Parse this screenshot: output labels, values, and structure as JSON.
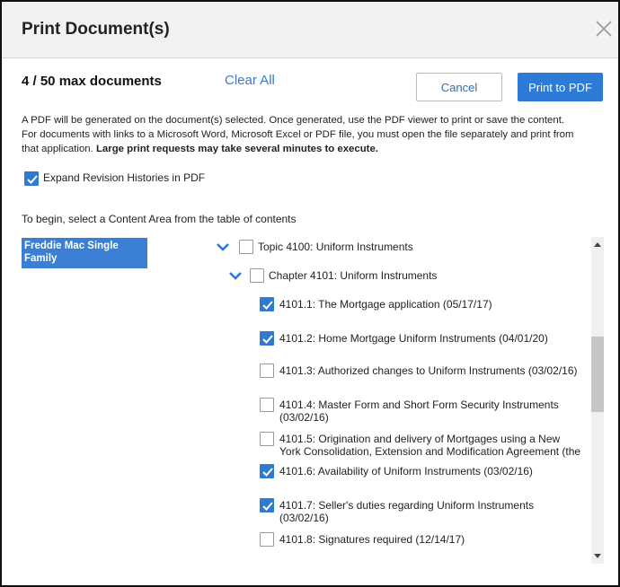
{
  "dialog": {
    "title": "Print Document(s)",
    "count_label": "4 / 50 max documents",
    "clear_all": "Clear All",
    "cancel_label": "Cancel",
    "print_label": "Print to PDF",
    "info_line1": "A PDF will be generated on the document(s) selected. Once generated, use the PDF viewer to print or save the content.",
    "info_line2": "For documents with links to a Microsoft Word, Microsoft Excel or PDF file, you must open the file separately and print from",
    "info_line3": "that application.",
    "info_bold": "Large print requests may take several minutes to execute.",
    "expand_label": "Expand Revision Histories in PDF",
    "expand_checked": true,
    "begin_text": "To begin, select a Content Area from the table of contents"
  },
  "content_areas": [
    {
      "label": "Freddie Mac Single Family",
      "selected": true
    }
  ],
  "tree": {
    "topic": {
      "label": "Topic 4100: Uniform Instruments",
      "checked": false,
      "expanded": true
    },
    "chapter": {
      "label": "Chapter 4101: Uniform Instruments",
      "checked": false,
      "expanded": true
    },
    "sections": [
      {
        "line1": "4101.1: The Mortgage application (05/17/17)",
        "line2": "",
        "checked": true
      },
      {
        "line1": "4101.2: Home Mortgage Uniform Instruments (04/01/20)",
        "line2": "",
        "checked": true
      },
      {
        "line1": "4101.3: Authorized changes to Uniform Instruments (03/02/16)",
        "line2": "",
        "checked": false
      },
      {
        "line1": "4101.4: Master Form and Short Form Security Instruments",
        "line2": "(03/02/16)",
        "checked": false
      },
      {
        "line1": "4101.5: Origination and delivery of Mortgages using a New",
        "line2": "York Consolidation, Extension and Modification Agreement (the",
        "checked": false
      },
      {
        "line1": "4101.6: Availability of Uniform Instruments (03/02/16)",
        "line2": "",
        "checked": true
      },
      {
        "line1": "4101.7: Seller's duties regarding Uniform Instruments",
        "line2": "(03/02/16)",
        "checked": true
      },
      {
        "line1": "4101.8: Signatures required (12/14/17)",
        "line2": "",
        "checked": false
      }
    ]
  },
  "colors": {
    "accent": "#2d7bd7",
    "link": "#3a7ac9",
    "selected_area": "#3a7fd4",
    "header_bg": "#f2f2f2"
  },
  "icons": {
    "close": "close-icon",
    "chevron": "chevron-down-icon",
    "check": "checkmark-icon"
  }
}
